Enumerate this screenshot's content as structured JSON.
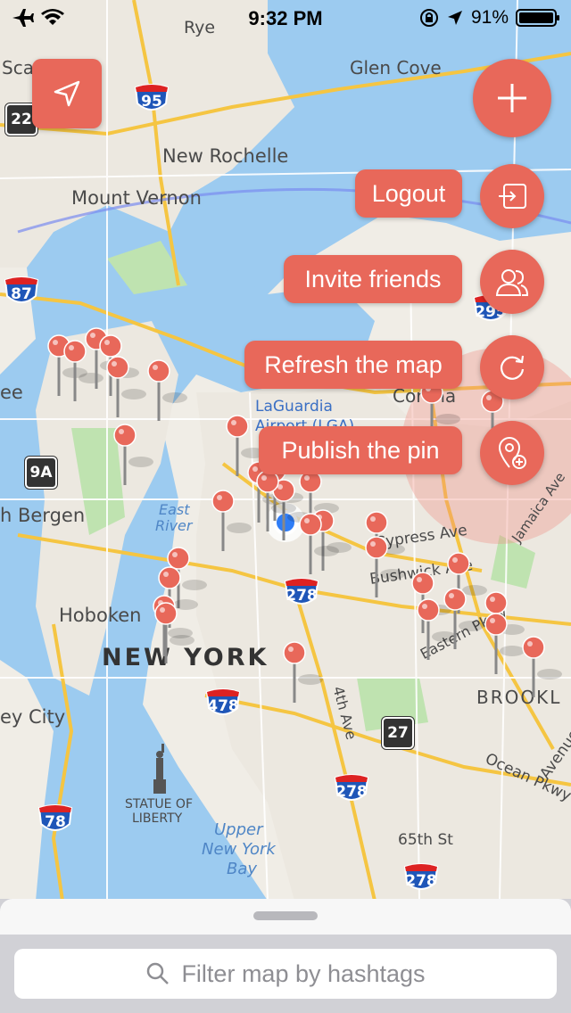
{
  "status_bar": {
    "time": "9:32 PM",
    "battery": "91%",
    "icons": [
      "airplane-icon",
      "wifi-icon",
      "orientation-lock-icon",
      "location-arrow-icon",
      "battery-icon"
    ]
  },
  "map": {
    "places": [
      {
        "name": "Rye"
      },
      {
        "name": "Glen Cove"
      },
      {
        "name": "New Rochelle"
      },
      {
        "name": "Mount Vernon"
      },
      {
        "name": "LaGuardia"
      },
      {
        "name": "Airport (LGA)"
      },
      {
        "name": "Corona"
      },
      {
        "name": "h Bergen"
      },
      {
        "name": "East"
      },
      {
        "name": "River"
      },
      {
        "name": "Cypress Ave"
      },
      {
        "name": "Bushwick Ave"
      },
      {
        "name": "Jamaica Ave"
      },
      {
        "name": "Eastern Pkwy"
      },
      {
        "name": "Hoboken"
      },
      {
        "name": "NEW YORK"
      },
      {
        "name": "BROOKL"
      },
      {
        "name": "4th Ave"
      },
      {
        "name": "ey City"
      },
      {
        "name": "STATUE OF"
      },
      {
        "name": "LIBERTY"
      },
      {
        "name": "Upper"
      },
      {
        "name": "New York"
      },
      {
        "name": "Bay"
      },
      {
        "name": "65th St"
      },
      {
        "name": "Ocean Pkwy"
      },
      {
        "name": "Avenue"
      },
      {
        "name": "Sca"
      },
      {
        "name": "ee"
      }
    ],
    "shields": [
      "95",
      "87",
      "295",
      "278",
      "478",
      "278",
      "78",
      "278"
    ],
    "square_shields": [
      "22",
      "9A",
      "27"
    ],
    "pin_color": "#e8685a"
  },
  "actions": {
    "locate_icon": "navigation-arrow-icon",
    "add_icon": "plus-icon",
    "logout_label": "Logout",
    "logout_icon": "logout-icon",
    "invite_label": "Invite friends",
    "invite_icon": "users-icon",
    "refresh_label": "Refresh the map",
    "refresh_icon": "refresh-icon",
    "publish_label": "Publish the pin",
    "publish_icon": "add-pin-icon",
    "accent": "#e8685a"
  },
  "search": {
    "placeholder": "Filter map by hashtags"
  }
}
